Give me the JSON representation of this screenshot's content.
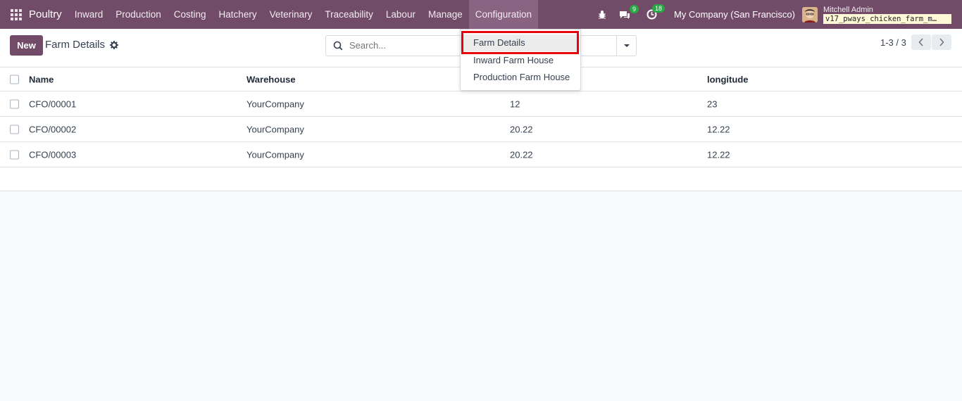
{
  "navbar": {
    "brand": "Poultry",
    "menu": [
      "Inward",
      "Production",
      "Costing",
      "Hatchery",
      "Veterinary",
      "Traceability",
      "Labour",
      "Manage",
      "Configuration"
    ],
    "messages_badge": "9",
    "activity_badge": "18",
    "company": "My Company (San Francisco)",
    "user_name": "Mitchell Admin",
    "database": "v17_pways_chicken_farm_m…",
    "accent_color": "#714b67"
  },
  "control": {
    "new_label": "New",
    "title": "Farm Details",
    "search_placeholder": "Search...",
    "pager": "1-3 / 3"
  },
  "table": {
    "headers": [
      "Name",
      "Warehouse",
      "",
      "longitude"
    ],
    "rows": [
      [
        "CFO/00001",
        "YourCompany",
        "12",
        "23"
      ],
      [
        "CFO/00002",
        "YourCompany",
        "20.22",
        "12.22"
      ],
      [
        "CFO/00003",
        "YourCompany",
        "20.22",
        "12.22"
      ]
    ]
  },
  "config_menu": {
    "items": [
      "Farm Details",
      "Inward Farm House",
      "Production Farm House"
    ],
    "highlight_color": "#e8000b"
  }
}
